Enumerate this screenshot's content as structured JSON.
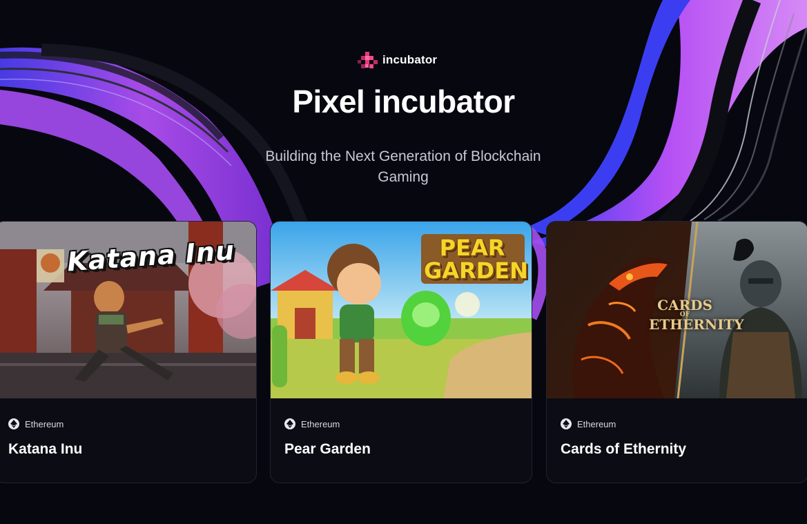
{
  "brand": {
    "logo_text": "incubator",
    "logo_mark": "pixel-logo-icon",
    "accent": "#e23a78"
  },
  "hero": {
    "title": "Pixel incubator",
    "subtitle": "Building the Next Generation of Blockchain Gaming"
  },
  "theme": {
    "background": "#07070f",
    "wave_purple": "#a54ff0",
    "wave_blue": "#3d49f0",
    "card_background": "#0c0c14"
  },
  "games": [
    {
      "name": "Katana Inu",
      "chain": "Ethereum",
      "chain_icon": "ethereum-icon",
      "art_title": "Katana Inu"
    },
    {
      "name": "Pear Garden",
      "chain": "Ethereum",
      "chain_icon": "ethereum-icon",
      "art_title_line1": "PEAR",
      "art_title_line2": "GARDEN"
    },
    {
      "name": "Cards of Ethernity",
      "chain": "Ethereum",
      "chain_icon": "ethereum-icon",
      "art_title_line1": "CARDS",
      "art_title_line2": "OF",
      "art_title_line3": "ETHERNITY"
    }
  ]
}
